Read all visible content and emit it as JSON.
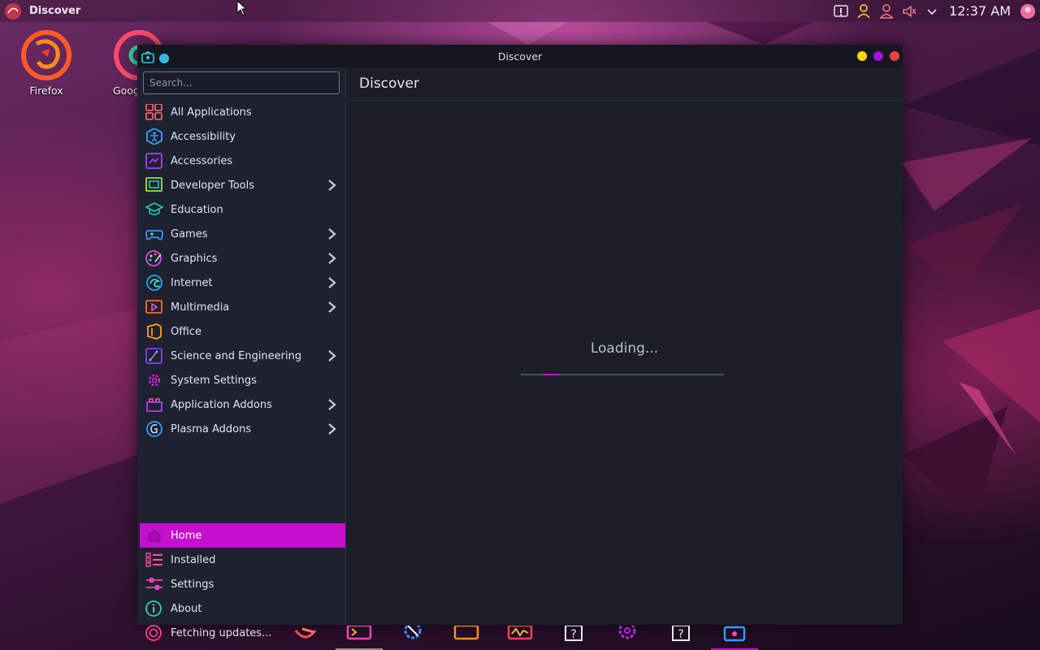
{
  "top_panel": {
    "app_title": "Discover",
    "clock": "12:37 AM"
  },
  "desktop": {
    "icons": [
      {
        "label": "Firefox",
        "icon": "firefox-icon"
      },
      {
        "label": "Google",
        "icon": "chrome-icon"
      }
    ]
  },
  "window": {
    "title": "Discover",
    "search": {
      "placeholder": "Search...",
      "value": ""
    },
    "categories": [
      {
        "label": "All Applications",
        "icon": "grid-icon",
        "has_children": false
      },
      {
        "label": "Accessibility",
        "icon": "accessibility-icon",
        "has_children": false
      },
      {
        "label": "Accessories",
        "icon": "accessories-icon",
        "has_children": false
      },
      {
        "label": "Developer Tools",
        "icon": "developer-tools-icon",
        "has_children": true
      },
      {
        "label": "Education",
        "icon": "education-icon",
        "has_children": false
      },
      {
        "label": "Games",
        "icon": "gamepad-icon",
        "has_children": true
      },
      {
        "label": "Graphics",
        "icon": "palette-icon",
        "has_children": true
      },
      {
        "label": "Internet",
        "icon": "internet-icon",
        "has_children": true
      },
      {
        "label": "Multimedia",
        "icon": "multimedia-icon",
        "has_children": true
      },
      {
        "label": "Office",
        "icon": "office-icon",
        "has_children": false
      },
      {
        "label": "Science and Engineering",
        "icon": "science-icon",
        "has_children": true
      },
      {
        "label": "System Settings",
        "icon": "system-settings-icon",
        "has_children": false
      },
      {
        "label": "Application Addons",
        "icon": "addons-icon",
        "has_children": true
      },
      {
        "label": "Plasma Addons",
        "icon": "plasma-icon",
        "has_children": true
      }
    ],
    "bottom_nav": [
      {
        "label": "Home",
        "icon": "home-icon",
        "active": true
      },
      {
        "label": "Installed",
        "icon": "installed-icon",
        "active": false
      },
      {
        "label": "Settings",
        "icon": "settings-sliders-icon",
        "active": false
      },
      {
        "label": "About",
        "icon": "info-icon",
        "active": false
      },
      {
        "label": "Fetching updates...",
        "icon": "updates-icon",
        "active": false
      }
    ],
    "main": {
      "title": "Discover",
      "loading_text": "Loading...",
      "progress": 0.08
    }
  },
  "colors": {
    "accent": "#c40fcf",
    "window_bg": "#1b1e29",
    "sidebar_bg": "#1e2130",
    "titlebar_bg": "#15171f",
    "btn_minimize": "#f5d800",
    "btn_maximize": "#a010e0",
    "btn_close": "#ee3f4a"
  },
  "dock": {
    "items": [
      "git-icon",
      "terminal-icon",
      "settings-gear-icon",
      "window-icon",
      "system-monitor-icon",
      "help-icon",
      "settings-cog-icon",
      "help-icon",
      "discover-icon"
    ]
  }
}
